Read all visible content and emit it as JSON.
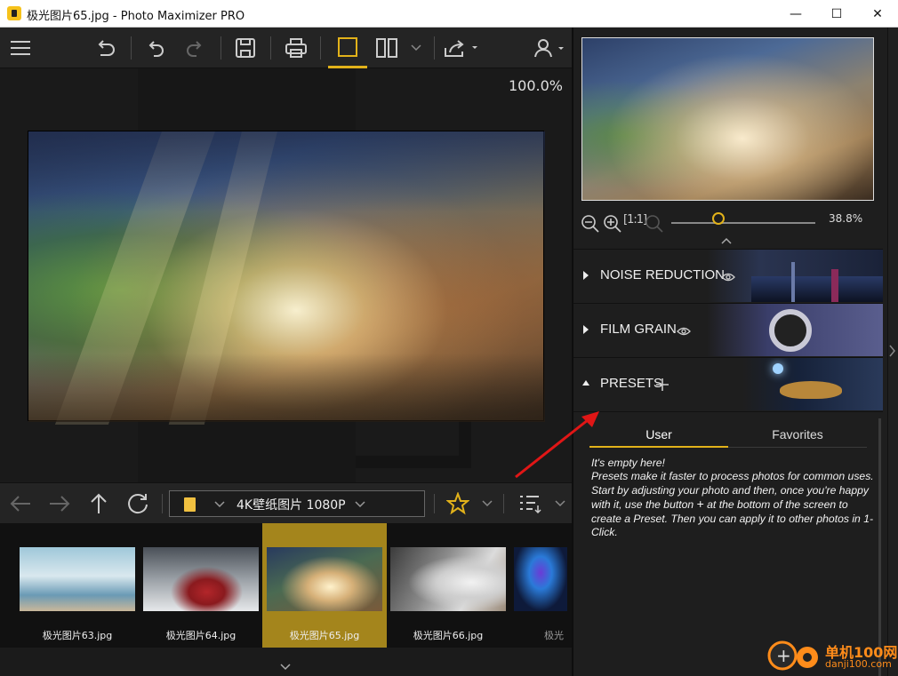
{
  "window": {
    "title": "极光图片65.jpg - Photo Maximizer PRO",
    "minimize": "—",
    "maximize": "☐",
    "close": "✕"
  },
  "toolbar": {
    "buttons": [
      "menu-icon",
      "undo-history-icon",
      "undo-icon",
      "redo-icon",
      "save-icon",
      "print-icon",
      "single-view-icon",
      "split-view-icon",
      "share-icon",
      "user-icon"
    ],
    "active_accent": "#e2b21a"
  },
  "canvas": {
    "zoom": "100.0%"
  },
  "navigator": {
    "zoom": "38.8%",
    "zoom_fraction": 0.33,
    "fit_label": "[1:1]"
  },
  "sections": [
    {
      "label": "NOISE REDUCTION",
      "expanded": false,
      "banner": "city-night"
    },
    {
      "label": "FILM GRAIN",
      "expanded": false,
      "banner": "camera"
    },
    {
      "label": "PRESETS",
      "expanded": true,
      "banner": "lamp"
    }
  ],
  "presets": {
    "tabs": [
      "User",
      "Favorites"
    ],
    "active_tab": "User",
    "help": {
      "line1": "It's empty here!",
      "line2a": "Presets make it faster to process photos for common uses. Start by adjusting your photo and then, once you're happy with it, use the button",
      "plus": "+",
      "line2b": "at the bottom of the screen to create a Preset. Then you can apply it to other photos in 1-Click."
    }
  },
  "browser": {
    "folder": "4K壁纸图片 1080P",
    "thumbnails": [
      {
        "name": "极光图片63.jpg",
        "selected": false
      },
      {
        "name": "极光图片64.jpg",
        "selected": false
      },
      {
        "name": "极光图片65.jpg",
        "selected": true
      },
      {
        "name": "极光图片66.jpg",
        "selected": false
      },
      {
        "name": "极光",
        "selected": false
      }
    ]
  },
  "watermark": {
    "title": "单机100网",
    "url": "danji100.com"
  }
}
